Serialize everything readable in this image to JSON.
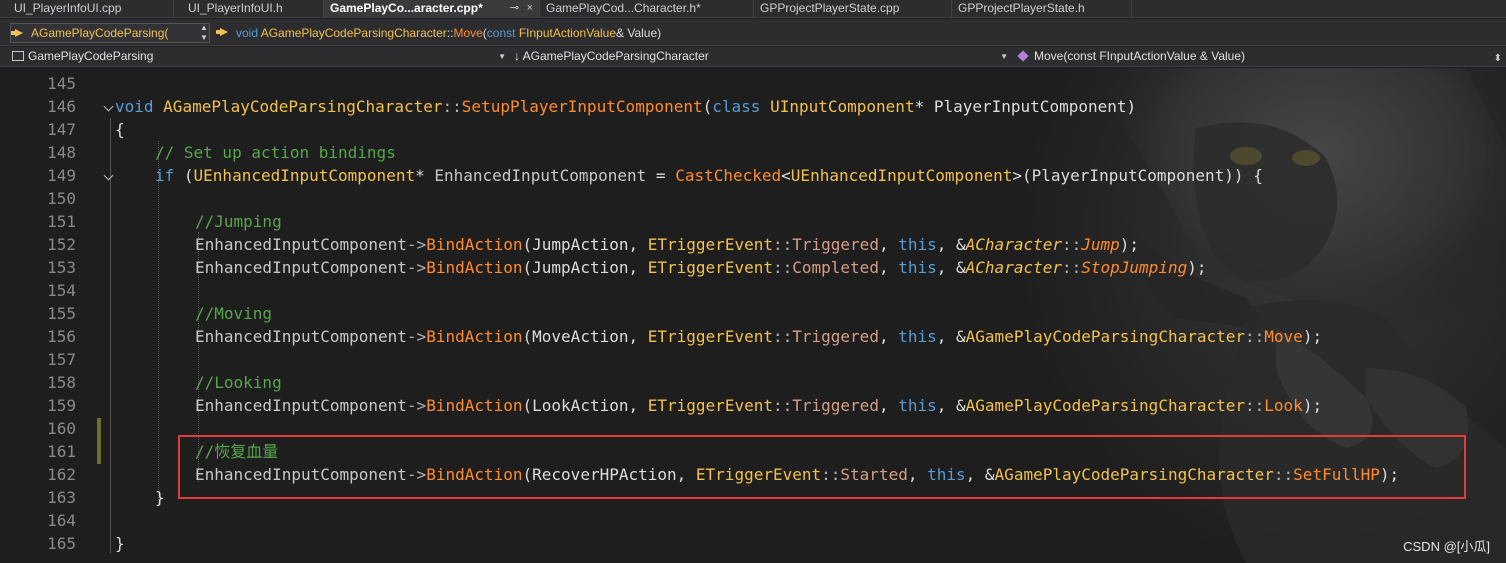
{
  "tabs": [
    {
      "label": "UI_PlayerInfoUI.cpp",
      "active": false
    },
    {
      "label": "UI_PlayerInfoUI.h",
      "active": false
    },
    {
      "label": "GamePlayCo...aracter.cpp*",
      "active": true
    },
    {
      "label": "GamePlayCod...Character.h*",
      "active": false
    },
    {
      "label": "GPProjectPlayerState.cpp",
      "active": false
    },
    {
      "label": "GPProjectPlayerState.h",
      "active": false
    }
  ],
  "active_tab_pin": "⊸",
  "active_tab_close": "×",
  "context": {
    "left_label": "AGamePlayCodeParsing(",
    "right_keyword": "void",
    "right_class": "AGamePlayCodeParsingCharacter",
    "right_sep": "::",
    "right_func": "Move",
    "right_open": "(",
    "right_const": "const",
    "right_type": "FInputActionValue",
    "right_rest": "& Value)"
  },
  "navbar": {
    "project": "GamePlayCodeParsing",
    "scope": "↓ AGamePlayCodeParsingCharacter",
    "member": "Move(const FInputActionValue & Value)"
  },
  "lines": [
    "145",
    "146",
    "147",
    "148",
    "149",
    "150",
    "151",
    "152",
    "153",
    "154",
    "155",
    "156",
    "157",
    "158",
    "159",
    "160",
    "161",
    "162",
    "163",
    "164",
    "165"
  ],
  "code": {
    "l146": {
      "kw1": "void",
      "cls": "AGamePlayCodeParsingCharacter",
      "sep": "::",
      "fn": "SetupPlayerInputComponent",
      "open": "(",
      "kw2": "class",
      "type": "UInputComponent",
      "rest": "* PlayerInputComponent)"
    },
    "l147": "{",
    "l148": "// Set up action bindings",
    "l149": {
      "kw": "if",
      "p1": " (",
      "type": "UEnhancedInputComponent",
      "star": "* ",
      "var": "EnhancedInputComponent",
      "eq": " = ",
      "fn": "CastChecked",
      "lt": "<",
      "type2": "UEnhancedInputComponent",
      "gt": ">",
      "rest": "(PlayerInputComponent)) {"
    },
    "l151": "//Jumping",
    "l152": {
      "obj": "EnhancedInputComponent",
      "arrow": "->",
      "fn": "BindAction",
      "a1": "(JumpAction, ",
      "enum": "ETriggerEvent",
      "sep": "::",
      "val": "Triggered",
      "comma": ", ",
      "this": "this",
      "amp": ", &",
      "cls": "ACharacter",
      "sep2": "::",
      "member": "Jump",
      "end": ");"
    },
    "l153": {
      "obj": "EnhancedInputComponent",
      "arrow": "->",
      "fn": "BindAction",
      "a1": "(JumpAction, ",
      "enum": "ETriggerEvent",
      "sep": "::",
      "val": "Completed",
      "comma": ", ",
      "this": "this",
      "amp": ", &",
      "cls": "ACharacter",
      "sep2": "::",
      "member": "StopJumping",
      "end": ");"
    },
    "l155": "//Moving",
    "l156": {
      "obj": "EnhancedInputComponent",
      "arrow": "->",
      "fn": "BindAction",
      "a1": "(MoveAction, ",
      "enum": "ETriggerEvent",
      "sep": "::",
      "val": "Triggered",
      "comma": ", ",
      "this": "this",
      "amp": ", &",
      "cls": "AGamePlayCodeParsingCharacter",
      "sep2": "::",
      "member": "Move",
      "end": ");"
    },
    "l158": "//Looking",
    "l159": {
      "obj": "EnhancedInputComponent",
      "arrow": "->",
      "fn": "BindAction",
      "a1": "(LookAction, ",
      "enum": "ETriggerEvent",
      "sep": "::",
      "val": "Triggered",
      "comma": ", ",
      "this": "this",
      "amp": ", &",
      "cls": "AGamePlayCodeParsingCharacter",
      "sep2": "::",
      "member": "Look",
      "end": ");"
    },
    "l161": "//恢复血量",
    "l162": {
      "obj": "EnhancedInputComponent",
      "arrow": "->",
      "fn": "BindAction",
      "a1": "(RecoverHPAction, ",
      "enum": "ETriggerEvent",
      "sep": "::",
      "val": "Started",
      "comma": ", ",
      "this": "this",
      "amp": ", &",
      "cls": "AGamePlayCodeParsingCharacter",
      "sep2": "::",
      "member": "SetFullHP",
      "end": ");"
    },
    "l163": "}",
    "l165": "}"
  },
  "watermark": "CSDN @[小瓜]",
  "colors": {
    "keyword": "#569cd6",
    "type": "#f2c14e",
    "function": "#ff8c2e",
    "comment": "#57a64a",
    "highlight": "#e03c3c"
  }
}
